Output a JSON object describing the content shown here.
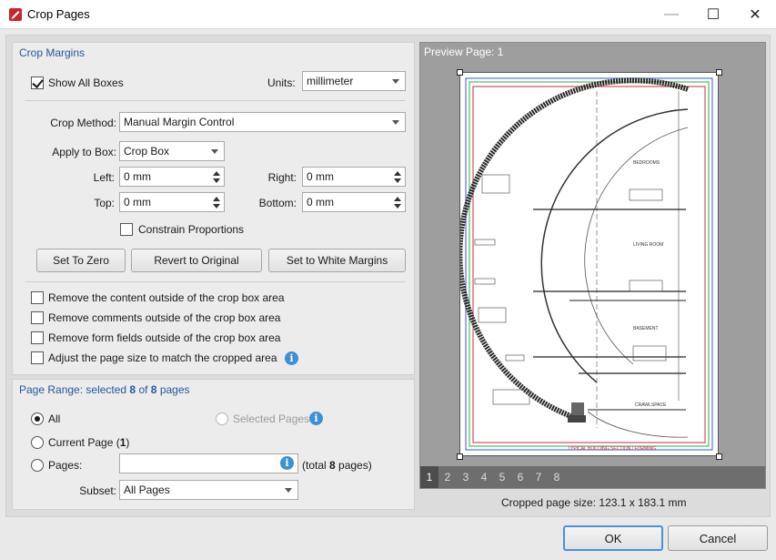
{
  "window": {
    "title": "Crop Pages",
    "minimize_glyph": "—",
    "maximize_glyph": "☐",
    "close_glyph": "✕"
  },
  "crop_margins": {
    "title": "Crop Margins",
    "show_all_boxes": {
      "label": "Show All Boxes",
      "checked": true
    },
    "units": {
      "label": "Units:",
      "value": "millimeter"
    },
    "crop_method": {
      "label": "Crop Method:",
      "value": "Manual Margin Control"
    },
    "apply_to_box": {
      "label": "Apply to Box:",
      "value": "Crop Box"
    },
    "left": {
      "label": "Left:",
      "value": "0 mm"
    },
    "right": {
      "label": "Right:",
      "value": "0 mm"
    },
    "top": {
      "label": "Top:",
      "value": "0 mm"
    },
    "bottom": {
      "label": "Bottom:",
      "value": "0 mm"
    },
    "constrain_proportions": {
      "label": "Constrain Proportions",
      "checked": false
    },
    "buttons": {
      "set_to_zero": "Set To Zero",
      "revert": "Revert to Original",
      "white_margins": "Set to White Margins"
    },
    "options": [
      {
        "label": "Remove the content outside of the crop box area",
        "checked": false
      },
      {
        "label": "Remove comments outside of the crop box area",
        "checked": false
      },
      {
        "label": "Remove form fields outside of the crop box area",
        "checked": false
      },
      {
        "label": "Adjust the page size to match the cropped area",
        "checked": false
      }
    ]
  },
  "page_range": {
    "title_prefix": "Page Range: selected ",
    "selected": "8",
    "of": " of ",
    "total": "8",
    "title_suffix": " pages",
    "all": "All",
    "selected_pages": "Selected Pages",
    "current_page_prefix": "Current Page (",
    "current_page_num": "1",
    "current_page_suffix": ")",
    "pages_label": "Pages:",
    "pages_value": "",
    "total_prefix": "(total ",
    "total_num": "8",
    "total_suffix": " pages)",
    "subset_label": "Subset:",
    "subset_value": "All Pages"
  },
  "preview": {
    "title": "Preview Page: 1",
    "page_tabs": [
      "1",
      "2",
      "3",
      "4",
      "5",
      "6",
      "7",
      "8"
    ],
    "active_tab": "1",
    "cropped_size": "Cropped page size: 123.1 x 183.1 mm",
    "drawing_caption": "TYPICAL BUILDING SECTION / FORMING",
    "room_labels": [
      "BEDROOMS",
      "LIVING ROOM",
      "BASEMENT",
      "CRAWLSPACE"
    ]
  },
  "footer": {
    "ok": "OK",
    "cancel": "Cancel"
  },
  "icons": {
    "app": "pdf-app-icon",
    "info": "info-icon"
  },
  "colors": {
    "accent": "#26579a",
    "info": "#3d8fd8",
    "crop_red": "#d22b2b",
    "crop_green": "#2fa84f",
    "crop_blue": "#2c5bd6"
  }
}
